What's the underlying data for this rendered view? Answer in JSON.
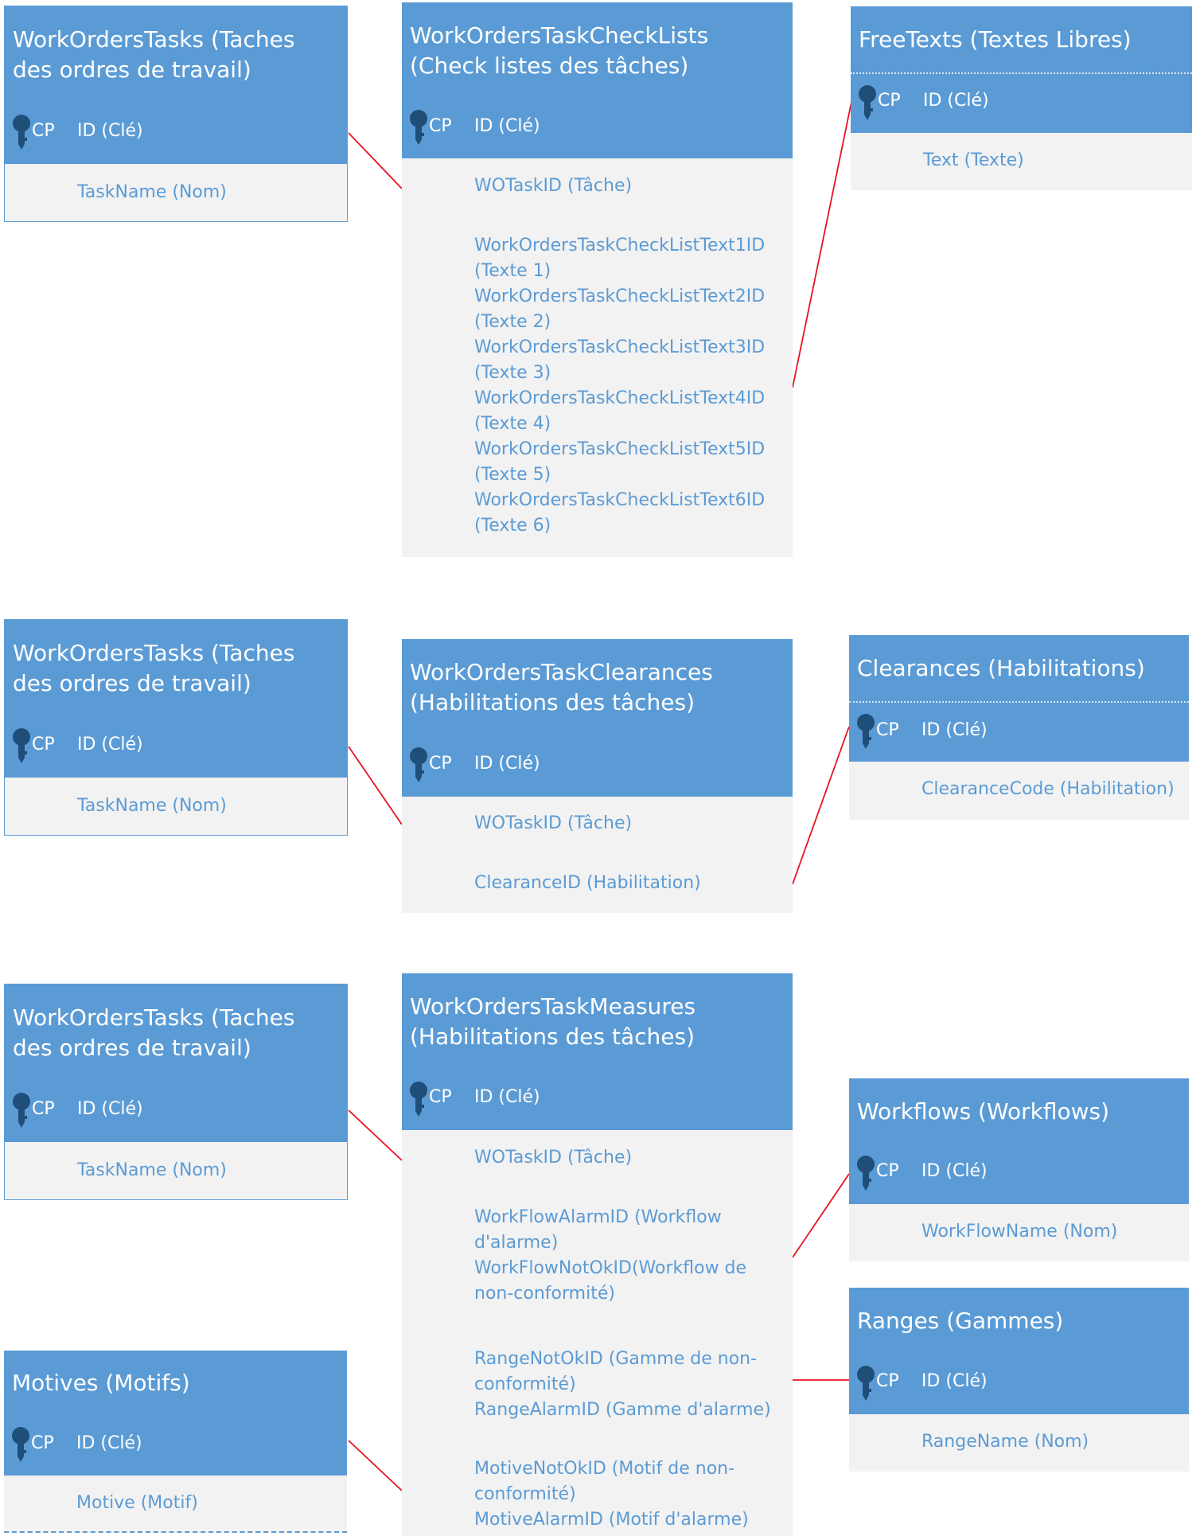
{
  "diagram_1": {
    "tasks": {
      "title": "WorkOrdersTasks (Taches des ordres de travail)",
      "pk_tag": "CP",
      "pk_field": "ID (Clé)",
      "fields": [
        "TaskName (Nom)"
      ]
    },
    "checklists": {
      "title": "WorkOrdersTaskCheckLists (Check listes des tâches)",
      "pk_tag": "CP",
      "pk_field": "ID (Clé)",
      "fields": [
        "WOTaskID (Tâche)",
        "WorkOrdersTaskCheckListText1ID (Texte 1)",
        "WorkOrdersTaskCheckListText2ID (Texte 2)",
        "WorkOrdersTaskCheckListText3ID (Texte 3)",
        "WorkOrdersTaskCheckListText4ID (Texte 4)",
        "WorkOrdersTaskCheckListText5ID (Texte 5)",
        "WorkOrdersTaskCheckListText6ID (Texte 6)"
      ]
    },
    "freetexts": {
      "title": "FreeTexts (Textes Libres)",
      "pk_tag": "CP",
      "pk_field": "ID (Clé)",
      "fields": [
        "Text (Texte)"
      ]
    }
  },
  "diagram_2": {
    "tasks": {
      "title": "WorkOrdersTasks (Taches des ordres de travail)",
      "pk_tag": "CP",
      "pk_field": "ID (Clé)",
      "fields": [
        "TaskName (Nom)"
      ]
    },
    "clearances_link": {
      "title": "WorkOrdersTaskClearances (Habilitations des tâches)",
      "pk_tag": "CP",
      "pk_field": "ID (Clé)",
      "fields": [
        "WOTaskID (Tâche)",
        "ClearanceID (Habilitation)"
      ]
    },
    "clearances": {
      "title": "Clearances (Habilitations)",
      "pk_tag": "CP",
      "pk_field": "ID (Clé)",
      "fields": [
        "ClearanceCode (Habilitation)"
      ]
    }
  },
  "diagram_3": {
    "tasks": {
      "title": "WorkOrdersTasks (Taches des ordres de travail)",
      "pk_tag": "CP",
      "pk_field": "ID (Clé)",
      "fields": [
        "TaskName (Nom)"
      ]
    },
    "measures": {
      "title": "WorkOrdersTaskMeasures (Habilitations des tâches)",
      "pk_tag": "CP",
      "pk_field": "ID (Clé)",
      "fields": [
        "WOTaskID (Tâche)",
        "WorkFlowAlarmID (Workflow d'alarme)",
        "WorkFlowNotOkID(Workflow de non-conformité)",
        "RangeNotOkID (Gamme de non-conformité)",
        "RangeAlarmID (Gamme d'alarme)",
        "MotiveNotOkID (Motif de non-conformité)",
        "MotiveAlarmID (Motif d'alarme)"
      ]
    },
    "workflows": {
      "title": "Workflows (Workflows)",
      "pk_tag": "CP",
      "pk_field": "ID (Clé)",
      "fields": [
        "WorkFlowName (Nom)"
      ]
    },
    "ranges": {
      "title": "Ranges (Gammes)",
      "pk_tag": "CP",
      "pk_field": "ID (Clé)",
      "fields": [
        "RangeName (Nom)"
      ]
    },
    "motives": {
      "title": "Motives (Motifs)",
      "pk_tag": "CP",
      "pk_field": "ID (Clé)",
      "fields": [
        "Motive (Motif)"
      ]
    }
  },
  "colors": {
    "entity": "#5b9bd5",
    "field_background": "#f2f2f2",
    "relation_line": "#e8121e",
    "key_icon": "#1f4e79"
  }
}
